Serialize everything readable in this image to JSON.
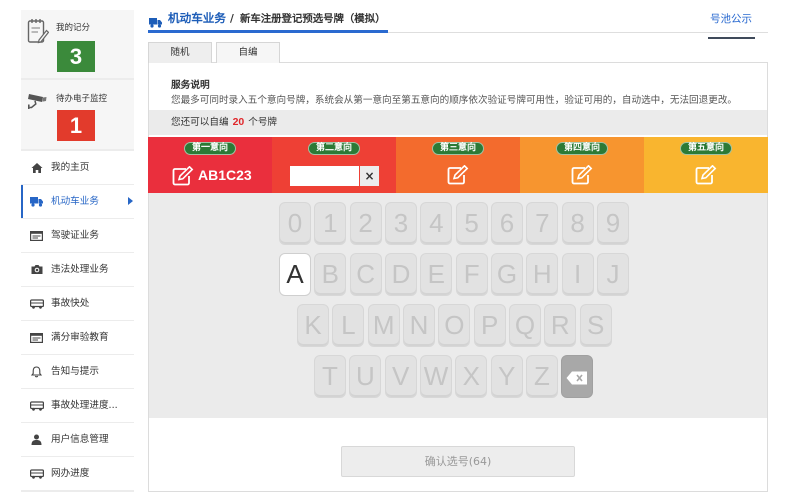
{
  "sidebar": {
    "score_card": {
      "label": "我的记分",
      "value": "3",
      "icon": "notepad-pencil-icon",
      "color": "#3b8a3b"
    },
    "monitor_card": {
      "label": "待办电子监控",
      "value": "1",
      "icon": "surveillance-camera-icon",
      "color": "#e23b2c"
    },
    "menu": [
      {
        "label": "我的主页",
        "icon": "home-icon"
      },
      {
        "label": "机动车业务",
        "icon": "truck-icon",
        "active": true
      },
      {
        "label": "驾驶证业务",
        "icon": "id-card-icon"
      },
      {
        "label": "违法处理业务",
        "icon": "camera-icon"
      },
      {
        "label": "事故快处",
        "icon": "car-icon"
      },
      {
        "label": "满分审验教育",
        "icon": "id-card-icon"
      },
      {
        "label": "告知与提示",
        "icon": "bell-icon"
      },
      {
        "label": "事故处理进度...",
        "icon": "car-icon"
      },
      {
        "label": "用户信息管理",
        "icon": "user-icon"
      },
      {
        "label": "网办进度",
        "icon": "car-icon"
      }
    ]
  },
  "header": {
    "icon": "truck-icon",
    "section": "机动车业务",
    "separator": "/",
    "page_title": "新车注册登记预选号牌（模拟）",
    "right_link": "号池公示"
  },
  "tabs": [
    {
      "label": "随机",
      "active": false
    },
    {
      "label": "自编",
      "active": true
    }
  ],
  "service": {
    "heading": "服务说明",
    "description": "您最多可同时录入五个意向号牌，系统会从第一意向至第五意向的顺序依次验证号牌可用性，验证可用的，自动选中，无法回退更改。"
  },
  "quota": {
    "prefix": "您还可以自编",
    "count": "20",
    "suffix": "个号牌"
  },
  "intentions": [
    {
      "label": "第一意向",
      "value": "AB1C23",
      "icon": "edit-icon",
      "color": "#ea2f3d"
    },
    {
      "label": "第二意向",
      "value": "",
      "clear_label": "×",
      "color": "#ee4035"
    },
    {
      "label": "第三意向",
      "icon": "edit-icon",
      "color": "#f36b2d"
    },
    {
      "label": "第四意向",
      "icon": "edit-icon",
      "color": "#f7952f"
    },
    {
      "label": "第五意向",
      "icon": "edit-icon",
      "color": "#f9b52f"
    }
  ],
  "keyboard": {
    "rows": [
      [
        "0",
        "1",
        "2",
        "3",
        "4",
        "5",
        "6",
        "7",
        "8",
        "9"
      ],
      [
        "A",
        "B",
        "C",
        "D",
        "E",
        "F",
        "G",
        "H",
        "I",
        "J"
      ],
      [
        "K",
        "L",
        "M",
        "N",
        "O",
        "P",
        "Q",
        "R",
        "S"
      ],
      [
        "T",
        "U",
        "V",
        "W",
        "X",
        "Y",
        "Z"
      ]
    ],
    "backspace_icon": "backspace-icon"
  },
  "confirm_button": {
    "label": "确认选号(64)"
  },
  "theme": {
    "accent": "#2766c6",
    "pill_green": "#2c7a36",
    "quota_red": "#e0262a"
  }
}
